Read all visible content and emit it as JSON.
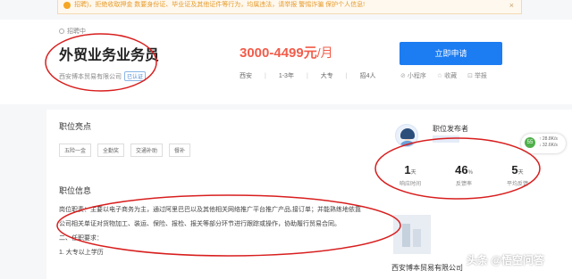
{
  "banner": {
    "text": "招聘)，拒绝收取押金 数要身份证、毕业证及其他证件等行为，均属违法，请举报 警惕诈骗 保护个人信息!"
  },
  "job": {
    "status": "招聘中",
    "title": "外贸业务业务员",
    "company": "西安博本贸易有限公司",
    "verify_badge": "已认证",
    "salary": "3000-4499元",
    "salary_unit": "/月",
    "meta": [
      "西安",
      "1-3年",
      "大专",
      "招4人"
    ],
    "apply_label": "立即申请",
    "actions": [
      {
        "icon": "mini-program-icon",
        "label": "小程序"
      },
      {
        "icon": "star-icon",
        "label": "收藏"
      },
      {
        "icon": "report-icon",
        "label": "举报"
      }
    ]
  },
  "highlights": {
    "title": "职位亮点",
    "tags": [
      "五险一金",
      "全勤奖",
      "交通补助",
      "餐补"
    ]
  },
  "info": {
    "title": "职位信息",
    "duties": "岗位职责：主要以电子商务为主，通过阿里巴巴以及其他相关网络推广平台推广产品,接订单；并能熟练地依靠公司相关单证对货物加工、装运、保险、报检、报关等部分环节进行跟踪或操作，协助履行贸易合同。",
    "req_title": "二、任职要求：",
    "req_1": "1. 大专以上学历"
  },
  "publisher": {
    "title": "职位发布者",
    "stats": [
      {
        "value": "1",
        "unit": "天",
        "label": "响应时间"
      },
      {
        "value": "46",
        "unit": "%",
        "label": "反馈率"
      },
      {
        "value": "5",
        "unit": "天",
        "label": "平均反馈"
      }
    ],
    "company_name": "西安博本贸易有限公司"
  },
  "float_widget": {
    "line1": "↑ 28.8K/s",
    "line2": "↓ 32.6K/s",
    "badge": "55"
  },
  "watermark": "头条 @悟空问答",
  "colors": {
    "accent": "#1c7cf2",
    "salary": "#f25c4a",
    "annotation": "#d81e1e"
  }
}
